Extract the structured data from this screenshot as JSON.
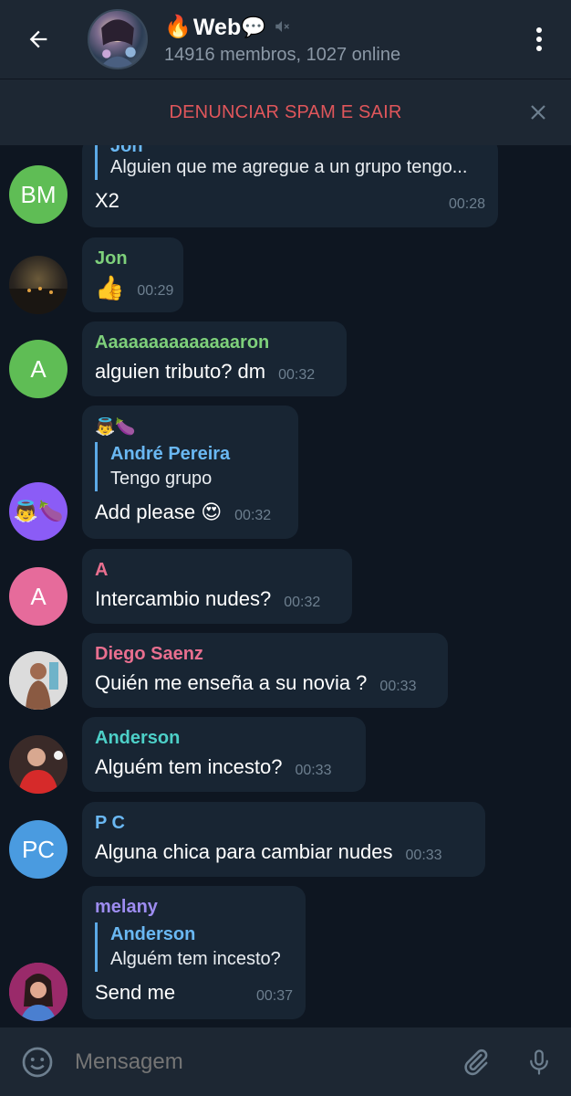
{
  "header": {
    "fire_emoji": "🔥",
    "title": "Web",
    "title_suffix": "💬",
    "subtitle": "14916 membros, 1027 online"
  },
  "spam_bar": {
    "label": "DENUNCIAR SPAM E SAIR"
  },
  "messages": [
    {
      "avatar_initials": "BM",
      "avatar_color": "#5fbd55",
      "reply_name": "Jon",
      "reply_text": "Alguien que me agregue a un grupo tengo...",
      "text": "X2",
      "time": "00:28"
    },
    {
      "sender": "Jon",
      "sender_color": "#7ed07b",
      "text": "👍",
      "time": "00:29"
    },
    {
      "avatar_initials": "A",
      "avatar_color": "#5fbd55",
      "sender": "Aaaaaaaaaaaaaaron",
      "sender_color": "#7ed07b",
      "text": "alguien tributo? dm",
      "time": "00:32"
    },
    {
      "sender": "👼🍆",
      "reply_name": "André Pereira",
      "reply_text": "Tengo grupo",
      "text": "Add please 😍",
      "time": "00:32"
    },
    {
      "avatar_initials": "A",
      "avatar_color": "#e66b9b",
      "sender": "A",
      "sender_color": "#e96f8f",
      "text": "Intercambio nudes?",
      "time": "00:32"
    },
    {
      "sender": "Diego Saenz",
      "sender_color": "#e96f8f",
      "text": "Quién me enseña a su novia ?",
      "time": "00:33"
    },
    {
      "sender": "Anderson",
      "sender_color": "#4dd0c8",
      "text": "Alguém tem incesto?",
      "time": "00:33"
    },
    {
      "avatar_initials": "PC",
      "avatar_color": "#4a9be0",
      "sender": "P C",
      "sender_color": "#6ab8f3",
      "text": "Alguna chica para cambiar nudes",
      "time": "00:33"
    },
    {
      "sender": "melany",
      "sender_color": "#9d8cf0",
      "reply_name": "Anderson",
      "reply_text": "Alguém tem incesto?",
      "text": "Send me",
      "time": "00:37"
    }
  ],
  "composer": {
    "placeholder": "Mensagem"
  }
}
